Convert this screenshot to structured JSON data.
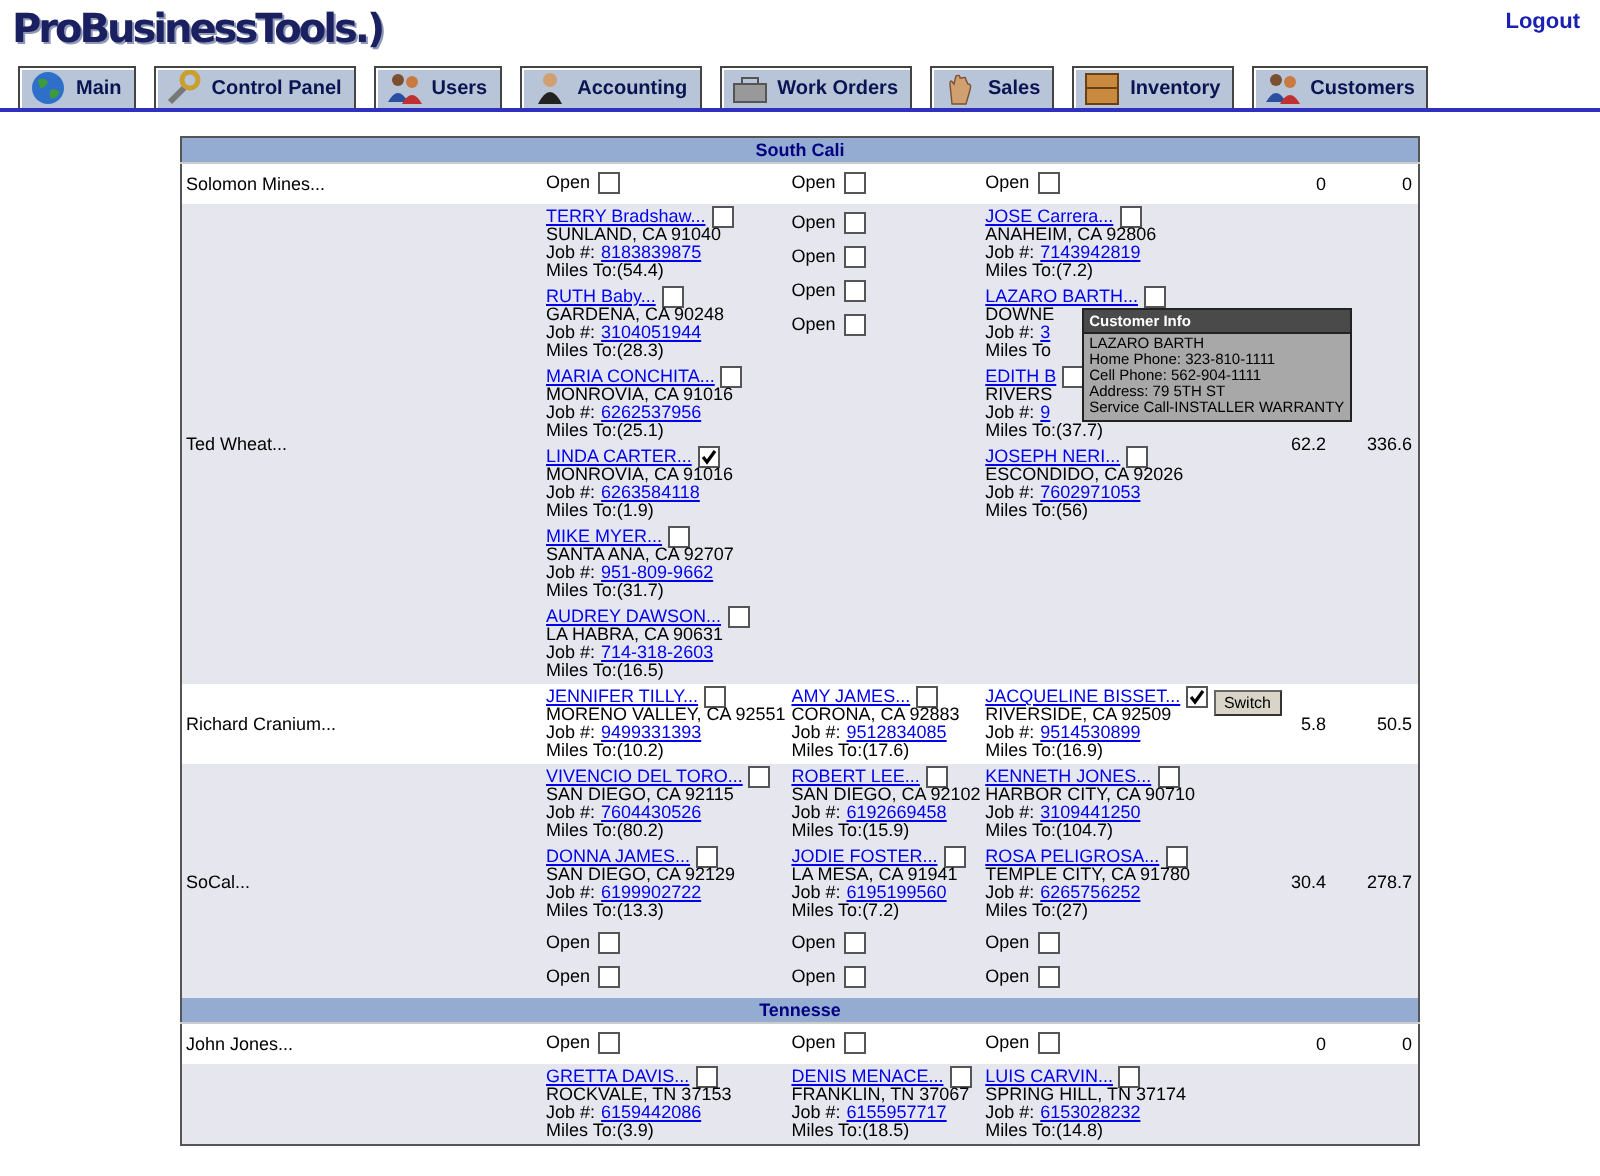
{
  "logo": "ProBusinessTools.)",
  "logout": "Logout",
  "tabs": [
    {
      "label": "Main",
      "selected": false
    },
    {
      "label": "Control Panel",
      "selected": false
    },
    {
      "label": "Users",
      "selected": false
    },
    {
      "label": "Accounting",
      "selected": false
    },
    {
      "label": "Work Orders",
      "selected": false
    },
    {
      "label": "Sales",
      "selected": false
    },
    {
      "label": "Inventory",
      "selected": false
    },
    {
      "label": "Customers",
      "selected": false
    }
  ],
  "sections": [
    {
      "title": "South Cali",
      "rows": [
        {
          "name": "Solomon Mines...",
          "columns": [
            [
              {
                "kind": "open",
                "label": "Open",
                "checked": false
              }
            ],
            [
              {
                "kind": "open",
                "label": "Open",
                "checked": false
              }
            ],
            [
              {
                "kind": "open",
                "label": "Open",
                "checked": false
              }
            ]
          ],
          "column_5": "0",
          "column_6": "0"
        },
        {
          "name": "Ted Wheat...",
          "columns": [
            [
              {
                "kind": "customer",
                "name": "TERRY Bradshaw...",
                "checked": false,
                "city": "SUNLAND, CA 91040",
                "job_label": "Job #:",
                "job": "8183839875",
                "miles": "Miles To:(54.4)"
              },
              {
                "kind": "customer",
                "name": "RUTH Baby...",
                "checked": false,
                "city": "GARDENA, CA 90248",
                "job_label": "Job #:",
                "job": "3104051944",
                "miles": "Miles To:(28.3)"
              },
              {
                "kind": "customer",
                "name": "MARIA CONCHITA...",
                "checked": false,
                "city": "MONROVIA, CA 91016",
                "job_label": "Job #:",
                "job": "6262537956",
                "miles": "Miles To:(25.1)"
              },
              {
                "kind": "customer",
                "name": "LINDA CARTER...",
                "checked": true,
                "city": "MONROVIA, CA 91016",
                "job_label": "Job #:",
                "job": "6263584118",
                "miles": "Miles To:(1.9)"
              },
              {
                "kind": "customer",
                "name": "MIKE MYER...",
                "checked": false,
                "city": "SANTA ANA, CA 92707",
                "job_label": "Job #:",
                "job": "951-809-9662",
                "miles": "Miles To:(31.7)"
              },
              {
                "kind": "customer",
                "name": "AUDREY DAWSON...",
                "checked": false,
                "city": "LA HABRA, CA 90631",
                "job_label": "Job #:",
                "job": "714-318-2603",
                "miles": "Miles To:(16.5)"
              }
            ],
            [
              {
                "kind": "open",
                "label": "Open",
                "checked": false
              },
              {
                "kind": "open",
                "label": "Open",
                "checked": false
              },
              {
                "kind": "open",
                "label": "Open",
                "checked": false
              },
              {
                "kind": "open",
                "label": "Open",
                "checked": false
              }
            ],
            [
              {
                "kind": "customer",
                "name": "JOSE Carrera...",
                "checked": false,
                "city": "ANAHEIM, CA 92806",
                "job_label": "Job #:",
                "job": "7143942819",
                "miles": "Miles To:(7.2)"
              },
              {
                "kind": "customer",
                "name": "LAZARO BARTH...",
                "checked": false,
                "city": "DOWNE",
                "job_label": "Job #:",
                "job": "3",
                "miles": "Miles To",
                "tooltip": {
                  "title": "Customer Info",
                  "lines": [
                    "LAZARO BARTH",
                    "Home Phone: 323-810-1111",
                    "Cell Phone: 562-904-1111",
                    "Address: 79 5TH ST",
                    "Service Call-INSTALLER WARRANTY"
                  ]
                }
              },
              {
                "kind": "customer",
                "name": "EDITH B",
                "checked": false,
                "city": "RIVERS",
                "job_label": "Job #:",
                "job": "9",
                "miles": "Miles To:(37.7)"
              },
              {
                "kind": "customer",
                "name": "JOSEPH NERI...",
                "checked": false,
                "city": "ESCONDIDO, CA 92026",
                "job_label": "Job #:",
                "job": "7602971053",
                "miles": "Miles To:(56)"
              }
            ]
          ],
          "column_5": "62.2",
          "column_6": "336.6"
        },
        {
          "name": "Richard Cranium...",
          "columns": [
            [
              {
                "kind": "customer",
                "name": "JENNIFER TILLY...",
                "checked": false,
                "city": "MORENO VALLEY, CA 92551",
                "job_label": "Job #:",
                "job": "9499331393",
                "miles": "Miles To:(10.2)"
              }
            ],
            [
              {
                "kind": "customer",
                "name": "AMY JAMES...",
                "checked": false,
                "city": "CORONA, CA 92883",
                "job_label": "Job #:",
                "job": "9512834085",
                "miles": "Miles To:(17.6)"
              }
            ],
            [
              {
                "kind": "customer",
                "name": "JACQUELINE BISSET...",
                "checked": true,
                "city": "RIVERSIDE, CA 92509",
                "job_label": "Job #:",
                "job": "9514530899",
                "miles": "Miles To:(16.9)"
              }
            ]
          ],
          "switch_button": "Switch",
          "column_5": "5.8",
          "column_6": "50.5"
        },
        {
          "name": "SoCal...",
          "columns": [
            [
              {
                "kind": "customer",
                "name": "VIVENCIO DEL TORO...",
                "checked": false,
                "city": "SAN DIEGO, CA 92115",
                "job_label": "Job #:",
                "job": "7604430526",
                "miles": "Miles To:(80.2)"
              },
              {
                "kind": "customer",
                "name": "DONNA JAMES...",
                "checked": false,
                "city": "SAN DIEGO, CA 92129",
                "job_label": "Job #:",
                "job": "6199902722",
                "miles": "Miles To:(13.3)"
              },
              {
                "kind": "open",
                "label": "Open",
                "checked": false
              },
              {
                "kind": "open",
                "label": "Open",
                "checked": false
              }
            ],
            [
              {
                "kind": "customer",
                "name": "ROBERT LEE...",
                "checked": false,
                "city": "SAN DIEGO, CA 92102",
                "job_label": "Job #:",
                "job": "6192669458",
                "miles": "Miles To:(15.9)"
              },
              {
                "kind": "customer",
                "name": "JODIE FOSTER...",
                "checked": false,
                "city": "LA MESA, CA 91941",
                "job_label": "Job #:",
                "job": "6195199560",
                "miles": "Miles To:(7.2)"
              },
              {
                "kind": "open",
                "label": "Open",
                "checked": false
              },
              {
                "kind": "open",
                "label": "Open",
                "checked": false
              }
            ],
            [
              {
                "kind": "customer",
                "name": "KENNETH JONES...",
                "checked": false,
                "city": "HARBOR CITY, CA 90710",
                "job_label": "Job #:",
                "job": "3109441250",
                "miles": "Miles To:(104.7)"
              },
              {
                "kind": "customer",
                "name": "ROSA PELIGROSA...",
                "checked": false,
                "city": "TEMPLE CITY, CA 91780",
                "job_label": "Job #:",
                "job": "6265756252",
                "miles": "Miles To:(27)"
              },
              {
                "kind": "open",
                "label": "Open",
                "checked": false
              },
              {
                "kind": "open",
                "label": "Open",
                "checked": false
              }
            ]
          ],
          "column_5": "30.4",
          "column_6": "278.7"
        }
      ]
    },
    {
      "title": "Tennesse",
      "rows": [
        {
          "name": "John Jones...",
          "columns": [
            [
              {
                "kind": "open",
                "label": "Open",
                "checked": false
              }
            ],
            [
              {
                "kind": "open",
                "label": "Open",
                "checked": false
              }
            ],
            [
              {
                "kind": "open",
                "label": "Open",
                "checked": false
              }
            ]
          ],
          "column_5": "0",
          "column_6": "0"
        },
        {
          "columns": [
            [
              {
                "kind": "customer",
                "name": "GRETTA DAVIS...",
                "checked": false,
                "city": "ROCKVALE, TN 37153",
                "job_label": "Job #:",
                "job": "6159442086",
                "miles": "Miles To:(3.9)"
              }
            ],
            [
              {
                "kind": "customer",
                "name": "DENIS MENACE...",
                "checked": false,
                "city": "FRANKLIN, TN 37067",
                "job_label": "Job #:",
                "job": "6155957717",
                "miles": "Miles To:(18.5)"
              }
            ],
            [
              {
                "kind": "customer",
                "name": "LUIS CARVIN...",
                "checked": false,
                "city": "SPRING HILL, TN 37174",
                "job_label": "Job #:",
                "job": "6153028232",
                "miles": "Miles To:(14.8)"
              }
            ]
          ]
        }
      ]
    }
  ]
}
